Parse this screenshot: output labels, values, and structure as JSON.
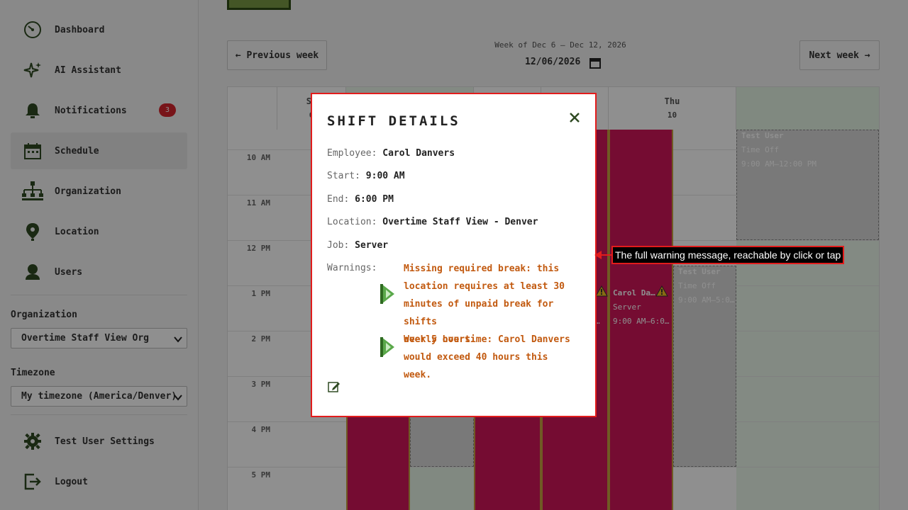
{
  "sidebar": {
    "items": [
      {
        "label": "Dashboard",
        "icon": "dashboard-icon"
      },
      {
        "label": "AI Assistant",
        "icon": "sparkle-icon"
      },
      {
        "label": "Notifications",
        "icon": "bell-icon",
        "badge": "3"
      },
      {
        "label": "Schedule",
        "icon": "calendar-icon",
        "active": true
      },
      {
        "label": "Organization",
        "icon": "org-chart-icon"
      },
      {
        "label": "Location",
        "icon": "map-pin-icon"
      },
      {
        "label": "Users",
        "icon": "user-icon"
      }
    ],
    "organization_label": "Organization",
    "organization_value": "Overtime Staff View Org",
    "timezone_label": "Timezone",
    "timezone_value": "My timezone (America/Denver)",
    "settings_label": "Test User Settings",
    "logout_label": "Logout"
  },
  "toolbar": {
    "prev_label": "← Previous week",
    "next_label": "Next week →",
    "week_title": "Week of Dec 6 – Dec 12, 2026",
    "date_value": "12/06/2026"
  },
  "calendar": {
    "columns": [
      {
        "name": "Su",
        "date": "6"
      },
      {
        "name": "Thu",
        "date": "10"
      }
    ],
    "hours": [
      "10 AM",
      "11 AM",
      "12 PM",
      "1 PM",
      "2 PM",
      "3 PM",
      "4 PM",
      "5 PM"
    ],
    "time_off": {
      "name": "Test User",
      "type": "Time Off",
      "time_a": "9:00 AM–12:00 PM",
      "time_b": "9:00 AM–5:0…"
    },
    "visible_shift": {
      "name": "Carol Da…",
      "job": "Server",
      "time": "9:00 AM–6:0…"
    },
    "partial_shift_time": "…"
  },
  "modal": {
    "title": "SHIFT DETAILS",
    "employee_label": "Employee:",
    "employee_value": "Carol Danvers",
    "start_label": "Start:",
    "start_value": "9:00 AM",
    "end_label": "End:",
    "end_value": "6:00 PM",
    "location_label": "Location:",
    "location_value": "Overtime Staff View - Denver",
    "job_label": "Job:",
    "job_value": "Server",
    "warnings_label": "Warnings:",
    "warnings": [
      {
        "lines": [
          "Missing required break: this",
          "location requires at least 30",
          "minutes of unpaid break for shifts",
          "over 5 hours."
        ]
      },
      {
        "lines": [
          "Weekly overtime: Carol Danvers",
          "would exceed 40 hours this week."
        ]
      }
    ]
  },
  "annotation": {
    "text": "The full warning message, reachable by click or tap"
  },
  "colors": {
    "shift": "#d0175a",
    "warning_text": "#c25a10",
    "accent_green": "#2f4a22",
    "badge": "#d7252e",
    "annotation_outline": "#e21c1c"
  }
}
